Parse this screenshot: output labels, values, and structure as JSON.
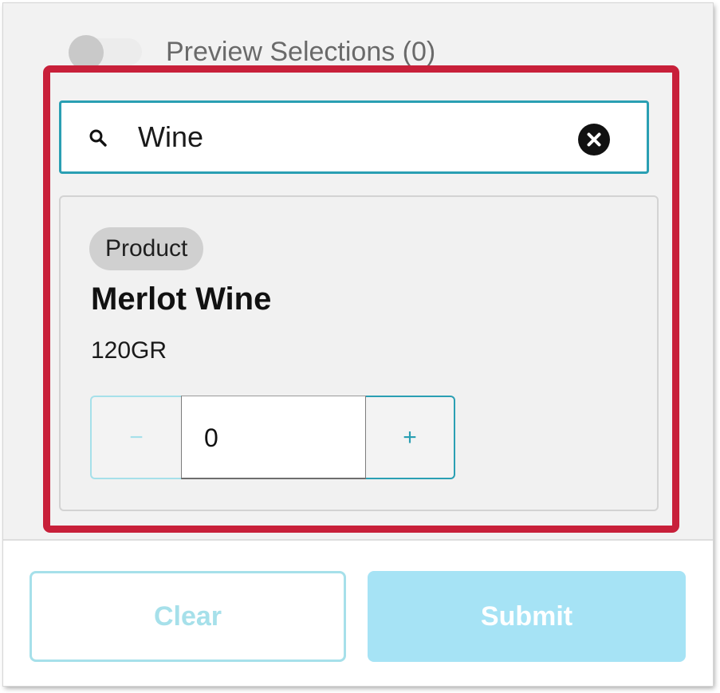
{
  "toggle": {
    "label": "Preview Selections (0)",
    "on": false
  },
  "search": {
    "value": "Wine",
    "icon": "search-icon",
    "clear_icon": "close-circle-icon"
  },
  "result": {
    "badge": "Product",
    "name": "Merlot Wine",
    "size": "120GR",
    "quantity": "0",
    "minus_label": "−",
    "plus_label": "+"
  },
  "footer": {
    "clear_label": "Clear",
    "submit_label": "Submit"
  },
  "colors": {
    "accent": "#2a9fb3",
    "highlight": "#c8203a",
    "disabled_accent": "#a6e0ea",
    "submit_bg": "#a6e3f5"
  }
}
